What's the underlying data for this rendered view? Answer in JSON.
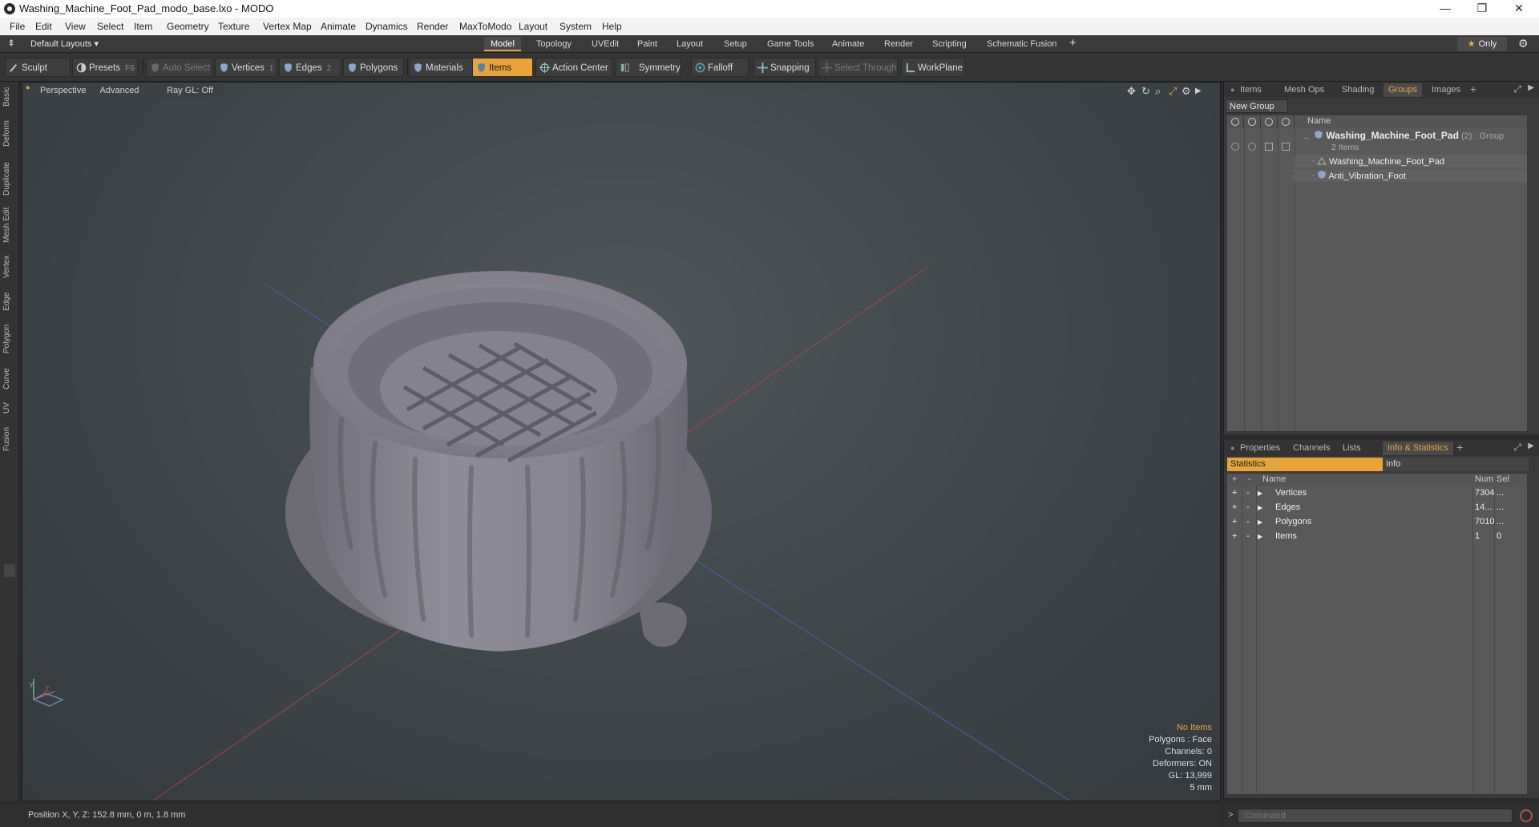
{
  "window": {
    "title": "Washing_Machine_Foot_Pad_modo_base.lxo - MODO",
    "minimize": "—",
    "maximize": "❐",
    "close": "✕"
  },
  "menu": [
    "File",
    "Edit",
    "View",
    "Select",
    "Item",
    "Geometry",
    "Texture",
    "Vertex Map",
    "Animate",
    "Dynamics",
    "Render",
    "MaxToModo",
    "Layout",
    "System",
    "Help"
  ],
  "layout_bar": {
    "dropdown": "Default Layouts ▾",
    "tabs": [
      "Model",
      "Topology",
      "UVEdit",
      "Paint",
      "Layout",
      "Setup",
      "Game Tools",
      "Animate",
      "Render",
      "Scripting",
      "Schematic Fusion"
    ],
    "active_tab": "Model",
    "only_label": "Only"
  },
  "toolbar": {
    "sculpt": "Sculpt",
    "presets": "Presets",
    "presets_key": "F6",
    "auto_select": "Auto Select",
    "vertices": "Vertices",
    "vertices_key": "1",
    "edges": "Edges",
    "edges_key": "2",
    "polygons": "Polygons",
    "materials": "Materials",
    "items": "Items",
    "action_center": "Action Center",
    "symmetry": "Symmetry",
    "falloff": "Falloff",
    "snapping": "Snapping",
    "select_through": "Select Through",
    "workplane": "WorkPlane"
  },
  "left_tabs": [
    "Basic",
    "Deform",
    "Duplicate",
    "Mesh Edit",
    "Vertex",
    "Edge",
    "Polygon",
    "Curve",
    "UV",
    "Fusion"
  ],
  "viewport": {
    "perspective": "Perspective",
    "advanced": "Advanced",
    "raygl": "Ray GL: Off",
    "info": {
      "no_items": "No Items",
      "polygons": "Polygons : Face",
      "channels": "Channels: 0",
      "deformers": "Deformers: ON",
      "gl": "GL: 13,999",
      "scale": "5 mm"
    },
    "axis_labels": {
      "y": "Y",
      "z": "Z"
    }
  },
  "status": {
    "position": "Position X, Y, Z:   152.8 mm, 0 m, 1.8 mm"
  },
  "groups_panel": {
    "tabs": [
      "Items",
      "Mesh Ops",
      "Shading",
      "Groups",
      "Images"
    ],
    "active_tab": "Groups",
    "new_group": "New Group",
    "name_header": "Name",
    "group_name": "Washing_Machine_Foot_Pad",
    "group_suffix": " (2) : Group",
    "group_count": "2 Items",
    "children": [
      "Washing_Machine_Foot_Pad",
      "Anti_Vibration_Foot"
    ]
  },
  "stats_panel": {
    "tabs": [
      "Properties",
      "Channels",
      "Lists",
      "Info & Statistics"
    ],
    "active_tab": "Info & Statistics",
    "sub_statistics": "Statistics",
    "sub_info": "Info",
    "headers": {
      "name": "Name",
      "num": "Num",
      "sel": "Sel"
    },
    "rows": [
      {
        "name": "Vertices",
        "num": "7304",
        "sel": "..."
      },
      {
        "name": "Edges",
        "num": "14...",
        "sel": "..."
      },
      {
        "name": "Polygons",
        "num": "7010",
        "sel": "..."
      },
      {
        "name": "Items",
        "num": "1",
        "sel": "0"
      }
    ]
  },
  "command": {
    "prompt": ">",
    "placeholder": "Command"
  },
  "colors": {
    "accent": "#e8a33a",
    "viewport_bg": "#444c50",
    "mesh": "#8e8c96"
  }
}
